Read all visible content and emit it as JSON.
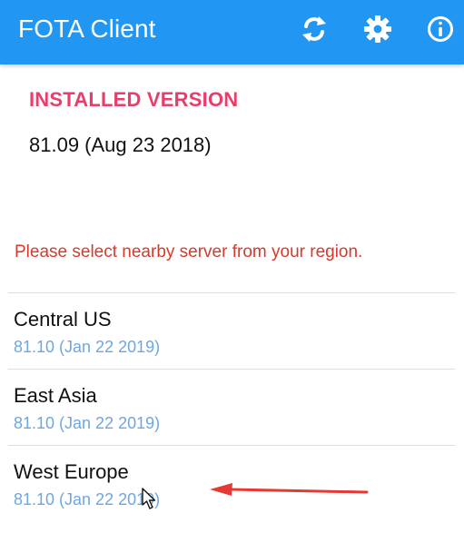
{
  "app_bar": {
    "title": "FOTA Client",
    "background_color": "#2196f3",
    "icons": {
      "sync": "sync-icon",
      "settings": "settings-icon",
      "info": "info-icon"
    }
  },
  "installed": {
    "heading": "INSTALLED VERSION",
    "version": "81.09 (Aug 23 2018)",
    "heading_color": "#e83e6c"
  },
  "region_message": {
    "text": "Please select nearby server from your region.",
    "color": "#d63a2a"
  },
  "servers": [
    {
      "name": "Central US",
      "version": "81.10 (Jan 22 2019)"
    },
    {
      "name": "East Asia",
      "version": "81.10 (Jan 22 2019)"
    },
    {
      "name": "West Europe",
      "version": "81.10 (Jan 22 2019)"
    }
  ],
  "annotation": {
    "arrow": "red-arrow-icon",
    "cursor": "mouse-cursor-icon",
    "arrow_color": "#e53935"
  }
}
